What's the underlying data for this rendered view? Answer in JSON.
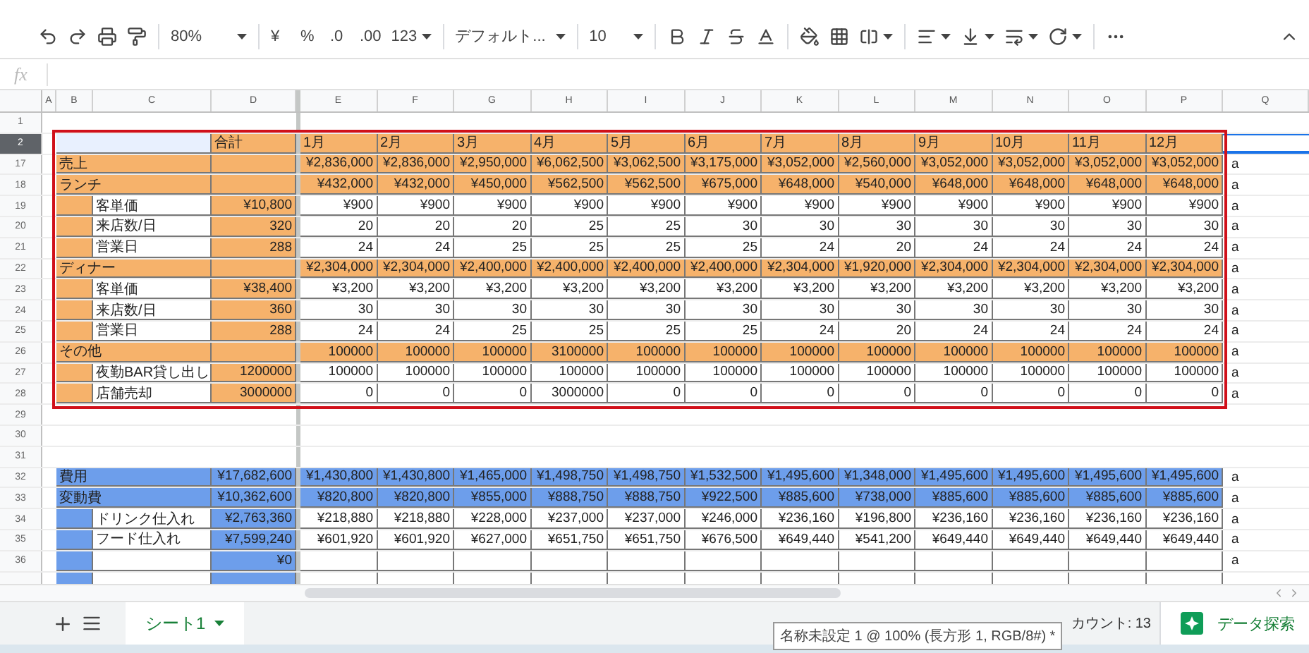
{
  "toolbar": {
    "zoom": "80%",
    "currency": "¥",
    "percent": "%",
    "decrease_decimal": ".0",
    "increase_decimal": ".00",
    "number_format": "123",
    "font": "デフォルト...",
    "font_size": "10"
  },
  "formula_bar": {
    "label": "fx"
  },
  "columns": [
    "A",
    "B",
    "C",
    "D",
    "E",
    "F",
    "G",
    "H",
    "I",
    "J",
    "K",
    "L",
    "M",
    "N",
    "O",
    "P",
    "Q"
  ],
  "months": [
    "1月",
    "2月",
    "3月",
    "4月",
    "5月",
    "6月",
    "7月",
    "8月",
    "9月",
    "10月",
    "11月",
    "12月"
  ],
  "rows": [
    {
      "num": "1",
      "kind": "blank",
      "selected": false
    },
    {
      "num": "2",
      "kind": "header",
      "selected": true,
      "color": "#f6b26b",
      "total": "合計"
    },
    {
      "num": "17",
      "kind": "head",
      "selected": false,
      "color": "#f6b26b",
      "label": "売上",
      "months": [
        "¥2,836,000",
        "¥2,836,000",
        "¥2,950,000",
        "¥6,062,500",
        "¥3,062,500",
        "¥3,175,000",
        "¥3,052,000",
        "¥2,560,000",
        "¥3,052,000",
        "¥3,052,000",
        "¥3,052,000",
        "¥3,052,000"
      ],
      "q": "a"
    },
    {
      "num": "18",
      "kind": "head",
      "selected": false,
      "color": "#f6b26b",
      "label": "ランチ",
      "months": [
        "¥432,000",
        "¥432,000",
        "¥450,000",
        "¥562,500",
        "¥562,500",
        "¥675,000",
        "¥648,000",
        "¥540,000",
        "¥648,000",
        "¥648,000",
        "¥648,000",
        "¥648,000"
      ],
      "q": "a"
    },
    {
      "num": "19",
      "kind": "item",
      "selected": false,
      "color": "#f6b26b",
      "label": "客単価",
      "total": "¥10,800",
      "months": [
        "¥900",
        "¥900",
        "¥900",
        "¥900",
        "¥900",
        "¥900",
        "¥900",
        "¥900",
        "¥900",
        "¥900",
        "¥900",
        "¥900"
      ],
      "q": "a"
    },
    {
      "num": "20",
      "kind": "item",
      "selected": false,
      "color": "#f6b26b",
      "label": "来店数/日",
      "total": "320",
      "months": [
        "20",
        "20",
        "20",
        "25",
        "25",
        "30",
        "30",
        "30",
        "30",
        "30",
        "30",
        "30"
      ],
      "q": "a"
    },
    {
      "num": "21",
      "kind": "item",
      "selected": false,
      "color": "#f6b26b",
      "label": "営業日",
      "total": "288",
      "months": [
        "24",
        "24",
        "25",
        "25",
        "25",
        "25",
        "24",
        "20",
        "24",
        "24",
        "24",
        "24"
      ],
      "q": "a"
    },
    {
      "num": "22",
      "kind": "head",
      "selected": false,
      "color": "#f6b26b",
      "label": "ディナー",
      "months": [
        "¥2,304,000",
        "¥2,304,000",
        "¥2,400,000",
        "¥2,400,000",
        "¥2,400,000",
        "¥2,400,000",
        "¥2,304,000",
        "¥1,920,000",
        "¥2,304,000",
        "¥2,304,000",
        "¥2,304,000",
        "¥2,304,000"
      ],
      "q": "a"
    },
    {
      "num": "23",
      "kind": "item",
      "selected": false,
      "color": "#f6b26b",
      "label": "客単価",
      "total": "¥38,400",
      "months": [
        "¥3,200",
        "¥3,200",
        "¥3,200",
        "¥3,200",
        "¥3,200",
        "¥3,200",
        "¥3,200",
        "¥3,200",
        "¥3,200",
        "¥3,200",
        "¥3,200",
        "¥3,200"
      ],
      "q": "a"
    },
    {
      "num": "24",
      "kind": "item",
      "selected": false,
      "color": "#f6b26b",
      "label": "来店数/日",
      "total": "360",
      "months": [
        "30",
        "30",
        "30",
        "30",
        "30",
        "30",
        "30",
        "30",
        "30",
        "30",
        "30",
        "30"
      ],
      "q": "a"
    },
    {
      "num": "25",
      "kind": "item",
      "selected": false,
      "color": "#f6b26b",
      "label": "営業日",
      "total": "288",
      "months": [
        "24",
        "24",
        "25",
        "25",
        "25",
        "25",
        "24",
        "20",
        "24",
        "24",
        "24",
        "24"
      ],
      "q": "a"
    },
    {
      "num": "26",
      "kind": "head",
      "selected": false,
      "color": "#f6b26b",
      "label": "その他",
      "months": [
        "100000",
        "100000",
        "100000",
        "3100000",
        "100000",
        "100000",
        "100000",
        "100000",
        "100000",
        "100000",
        "100000",
        "100000"
      ],
      "q": "a"
    },
    {
      "num": "27",
      "kind": "item",
      "selected": false,
      "color": "#f6b26b",
      "label": "夜勤BAR貸し出し",
      "total": "1200000",
      "months": [
        "100000",
        "100000",
        "100000",
        "100000",
        "100000",
        "100000",
        "100000",
        "100000",
        "100000",
        "100000",
        "100000",
        "100000"
      ],
      "q": "a"
    },
    {
      "num": "28",
      "kind": "item",
      "selected": false,
      "color": "#f6b26b",
      "label": "店舗売却",
      "total": "3000000",
      "months": [
        "0",
        "0",
        "0",
        "3000000",
        "0",
        "0",
        "0",
        "0",
        "0",
        "0",
        "0",
        "0"
      ],
      "q": "a"
    },
    {
      "num": "29",
      "kind": "blank",
      "selected": false
    },
    {
      "num": "30",
      "kind": "blank",
      "selected": false
    },
    {
      "num": "31",
      "kind": "blank",
      "selected": false
    },
    {
      "num": "32",
      "kind": "head",
      "selected": false,
      "color": "#6d9eeb",
      "label": "費用",
      "total": "¥17,682,600",
      "months": [
        "¥1,430,800",
        "¥1,430,800",
        "¥1,465,000",
        "¥1,498,750",
        "¥1,498,750",
        "¥1,532,500",
        "¥1,495,600",
        "¥1,348,000",
        "¥1,495,600",
        "¥1,495,600",
        "¥1,495,600",
        "¥1,495,600"
      ],
      "q": "a"
    },
    {
      "num": "33",
      "kind": "head",
      "selected": false,
      "color": "#6d9eeb",
      "label": "変動費",
      "total": "¥10,362,600",
      "months": [
        "¥820,800",
        "¥820,800",
        "¥855,000",
        "¥888,750",
        "¥888,750",
        "¥922,500",
        "¥885,600",
        "¥738,000",
        "¥885,600",
        "¥885,600",
        "¥885,600",
        "¥885,600"
      ],
      "q": "a"
    },
    {
      "num": "34",
      "kind": "item",
      "selected": false,
      "color": "#6d9eeb",
      "label": "ドリンク仕入れ",
      "total": "¥2,763,360",
      "months": [
        "¥218,880",
        "¥218,880",
        "¥228,000",
        "¥237,000",
        "¥237,000",
        "¥246,000",
        "¥236,160",
        "¥196,800",
        "¥236,160",
        "¥236,160",
        "¥236,160",
        "¥236,160"
      ],
      "q": "a"
    },
    {
      "num": "35",
      "kind": "item",
      "selected": false,
      "color": "#6d9eeb",
      "label": "フード仕入れ",
      "total": "¥7,599,240",
      "months": [
        "¥601,920",
        "¥601,920",
        "¥627,000",
        "¥651,750",
        "¥651,750",
        "¥676,500",
        "¥649,440",
        "¥541,200",
        "¥649,440",
        "¥649,440",
        "¥649,440",
        "¥649,440"
      ],
      "q": "a"
    },
    {
      "num": "36",
      "kind": "item",
      "selected": false,
      "color": "#6d9eeb",
      "total": "¥0",
      "q": "a"
    },
    {
      "kind": "item",
      "selected": false,
      "color": "#6d9eeb"
    }
  ],
  "sheet_tabs": [
    {
      "label": "シート1",
      "selected": true
    }
  ],
  "status": {
    "count": "カウント: 13"
  },
  "explore_button": "データ探索",
  "tooltip": "名称未設定 1 @ 100% (長方形 1, RGB/8#) *"
}
